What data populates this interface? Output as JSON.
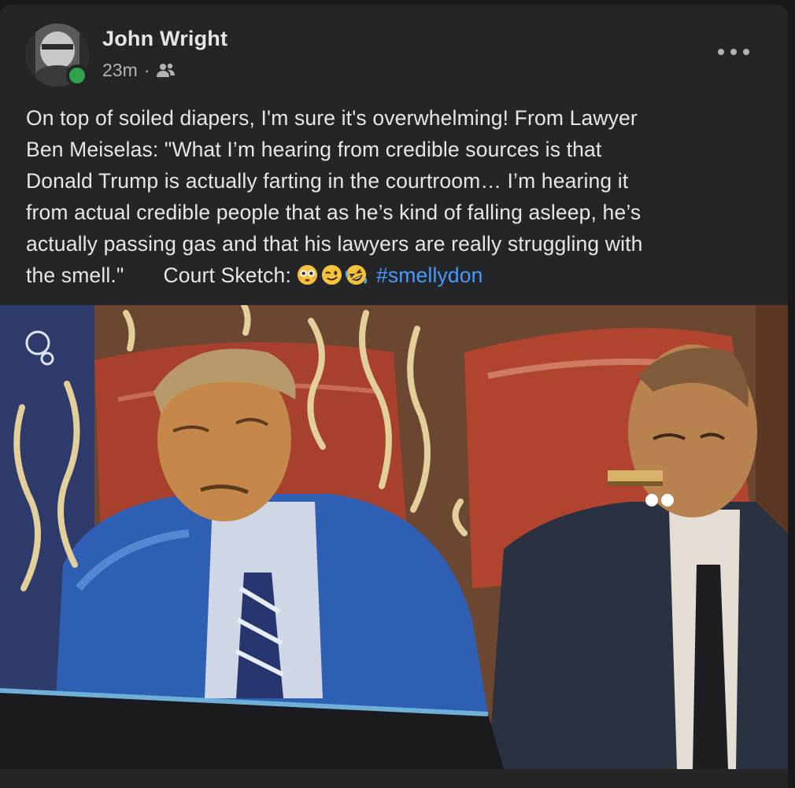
{
  "post": {
    "author": "John Wright",
    "time": "23m",
    "separator": "·",
    "audience_icon": "friends-icon",
    "menu_icon": "more-options-icon",
    "text_lines": [
      "On top of soiled diapers, I'm sure it's overwhelming! From Lawyer",
      "Ben Meiselas: \"What I’m hearing from credible sources is that",
      "Donald Trump is actually farting in the courtroom… I’m hearing it",
      "from actual credible people that as he’s kind of falling asleep, he’s",
      "actually passing gas and that his lawyers are really struggling with"
    ],
    "last_line_start": "the smell.\"",
    "last_line_label": "Court Sketch:",
    "emojis": [
      "flushed-face-icon",
      "winking-face-icon",
      "rolling-laughing-icon"
    ],
    "hashtag": "#smellydon",
    "image": "courtroom-sketch-image"
  },
  "colors": {
    "background": "#18191a",
    "card": "#242526",
    "text": "#e4e6eb",
    "secondary": "#b0b3b8",
    "link": "#4599ff",
    "online": "#31a24c"
  }
}
